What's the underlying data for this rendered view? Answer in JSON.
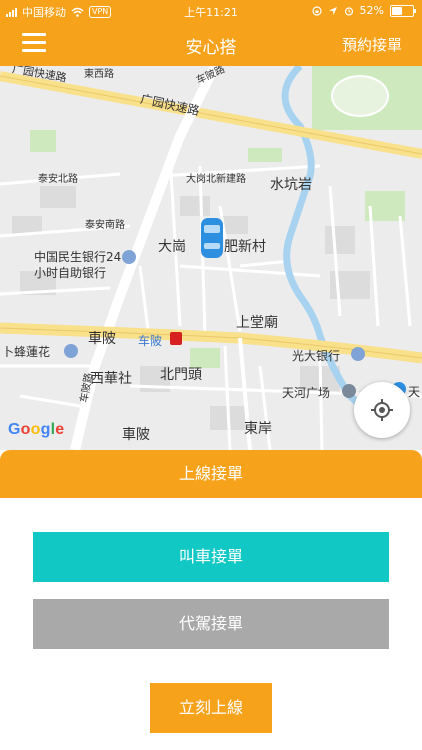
{
  "status_bar": {
    "carrier": "中国移动",
    "vpn": "VPN",
    "time": "上午11:21",
    "battery_percent": 52,
    "battery_label": "52%"
  },
  "navbar": {
    "title": "安心搭",
    "right_action": "預約接單"
  },
  "map": {
    "labels": {
      "east_road": "東西路",
      "chebei_road_top": "车陂路",
      "guangyuan_expressway": "广园快速路",
      "guangyuan_expressway_left": "广园快速路",
      "taianbei_road": "泰安北路",
      "taiannan_road": "泰安南路",
      "dagangbei_new_road": "大岗北新建路",
      "shuikeng_yan": "水坑岩",
      "bank": "中国民生银行24",
      "bank_line2": "小时自助银行",
      "dagang": "大崗",
      "feixin_village": "肥新村",
      "chebei": "車陂",
      "chebei_station": "车陂",
      "shangtang_temple": "上堂廟",
      "lianhua": "卜蜂蓮花",
      "everbright_bank": "光大银行",
      "xihua_society": "西華社",
      "beimen_tou": "北門頭",
      "tianhe_plaza": "天河广场",
      "tian_edge": "天",
      "chebei_bottom": "車陂",
      "dongan": "東岸",
      "chebei_road_vertical": "车陂路",
      "google": "Google"
    },
    "colors": {
      "road": "#ffffff",
      "expressway": "#f9e08a",
      "water": "#a7d3f0",
      "park": "#c7e7b6"
    }
  },
  "panel": {
    "online_button": "上線接單",
    "call_button": "叫車接單",
    "driver_button": "代駕接單",
    "now_button": "立刻上線"
  },
  "colors": {
    "brand_orange": "#f7a21b",
    "teal": "#11c8c4",
    "gray": "#a9a9a9"
  }
}
